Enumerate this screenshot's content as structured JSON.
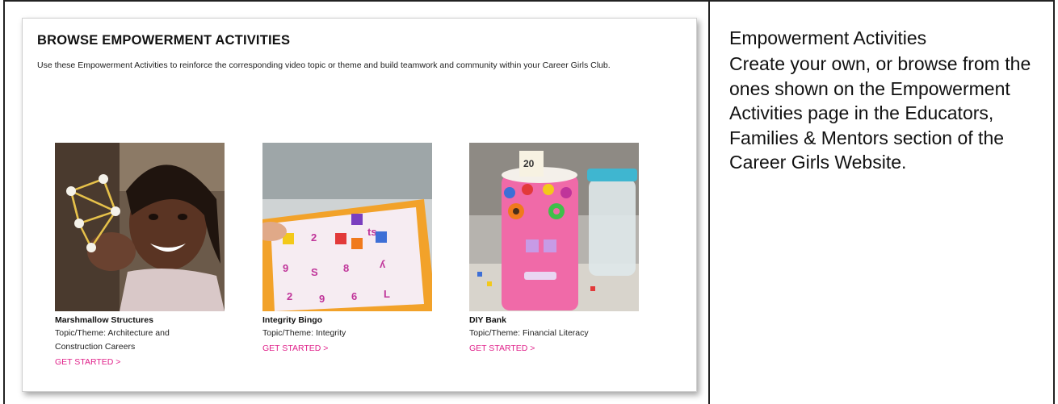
{
  "browse": {
    "title": "BROWSE EMPOWERMENT ACTIVITIES",
    "description": "Use these Empowerment Activities to reinforce the corresponding video topic or theme and build teamwork and community within your Career Girls Club."
  },
  "activities": [
    {
      "name": "Marshmallow Structures",
      "topic": "Topic/Theme: Architecture and Construction Careers",
      "link": "GET STARTED >"
    },
    {
      "name": "Integrity Bingo",
      "topic": "Topic/Theme: Integrity",
      "link": "GET STARTED >"
    },
    {
      "name": "DIY Bank",
      "topic": "Topic/Theme: Financial Literacy",
      "link": "GET STARTED >"
    }
  ],
  "side": {
    "heading": "Empowerment Activities",
    "body": "Create your own, or browse from the ones shown on the Empowerment Activities page in the Educators, Families & Mentors section of the Career Girls Website."
  },
  "colors": {
    "link": "#e0218a",
    "frame": "#222222"
  }
}
